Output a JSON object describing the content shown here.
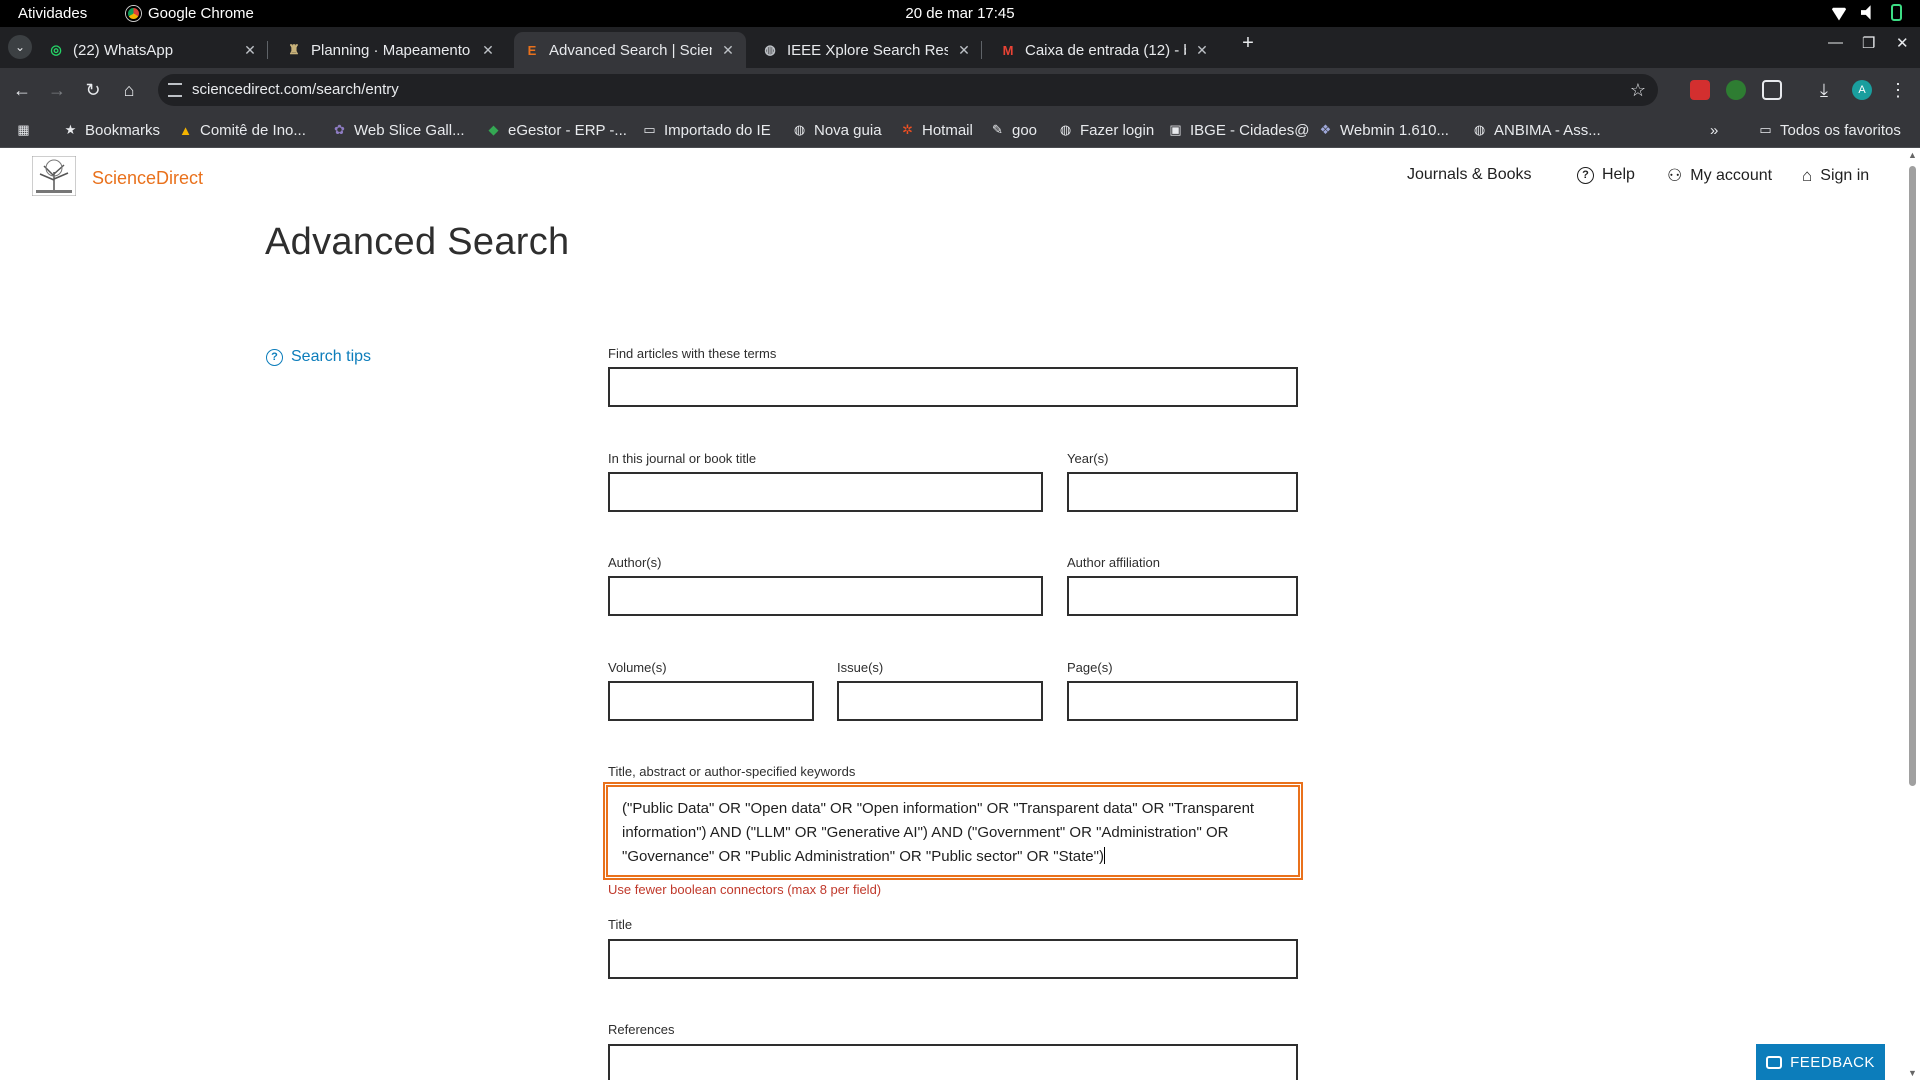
{
  "system": {
    "activities": "Atividades",
    "app_name": "Google Chrome",
    "clock": "20 de mar  17:45"
  },
  "tabs": [
    {
      "label": "(22) WhatsApp",
      "icon": "whatsapp-icon",
      "active": false
    },
    {
      "label": "Planning · Mapeamento",
      "icon": "planning-icon",
      "active": false
    },
    {
      "label": "Advanced Search | Scienc",
      "icon": "elsevier-icon",
      "active": true
    },
    {
      "label": "IEEE Xplore Search Resu",
      "icon": "globe-icon",
      "active": false
    },
    {
      "label": "Caixa de entrada (12) - b",
      "icon": "gmail-icon",
      "active": false
    }
  ],
  "toolbar": {
    "url": "sciencedirect.com/search/entry"
  },
  "bookmarks": {
    "items": [
      {
        "label": "Bookmarks",
        "icon": "star-icon"
      },
      {
        "label": "Comitê de Ino...",
        "icon": "drive-icon"
      },
      {
        "label": "Web Slice Gall...",
        "icon": "slice-icon"
      },
      {
        "label": "eGestor - ERP -...",
        "icon": "egestor-icon"
      },
      {
        "label": "Importado do IE",
        "icon": "folder-icon"
      },
      {
        "label": "Nova guia",
        "icon": "globe-icon"
      },
      {
        "label": "Hotmail",
        "icon": "msn-icon"
      },
      {
        "label": "goo",
        "icon": "goo-icon"
      },
      {
        "label": "Fazer login",
        "icon": "globe-icon"
      },
      {
        "label": "IBGE - Cidades@",
        "icon": "ibge-icon"
      },
      {
        "label": "Webmin 1.610...",
        "icon": "webmin-icon"
      },
      {
        "label": "ANBIMA - Ass...",
        "icon": "globe-icon"
      }
    ],
    "overflow": "»",
    "all_bookmarks": "Todos os favoritos"
  },
  "site": {
    "brand": "ScienceDirect",
    "nav": {
      "journals": "Journals & Books",
      "help": "Help",
      "account": "My account",
      "signin": "Sign in"
    }
  },
  "form": {
    "heading": "Advanced Search",
    "search_tips": "Search tips",
    "labels": {
      "terms": "Find articles with these terms",
      "journal": "In this journal or book title",
      "years": "Year(s)",
      "authors": "Author(s)",
      "affiliation": "Author affiliation",
      "volume": "Volume(s)",
      "issue": "Issue(s)",
      "pages": "Page(s)",
      "keywords": "Title, abstract or author-specified keywords",
      "title": "Title",
      "references": "References"
    },
    "keywords_value": "(\"Public Data\" OR \"Open data\" OR \"Open information\" OR \"Transparent data\" OR \"Transparent information\") AND (\"LLM\" OR \"Generative AI\") AND (\"Government\" OR \"Administration\" OR \"Governance\" OR \"Public Administration\" OR \"Public sector\" OR \"State\")",
    "error": "Use fewer boolean connectors (max 8 per field)"
  },
  "feedback": "FEEDBACK",
  "colors": {
    "brand_orange": "#e9711c",
    "link_blue": "#0c7dbb",
    "error_red": "#c0392b"
  }
}
